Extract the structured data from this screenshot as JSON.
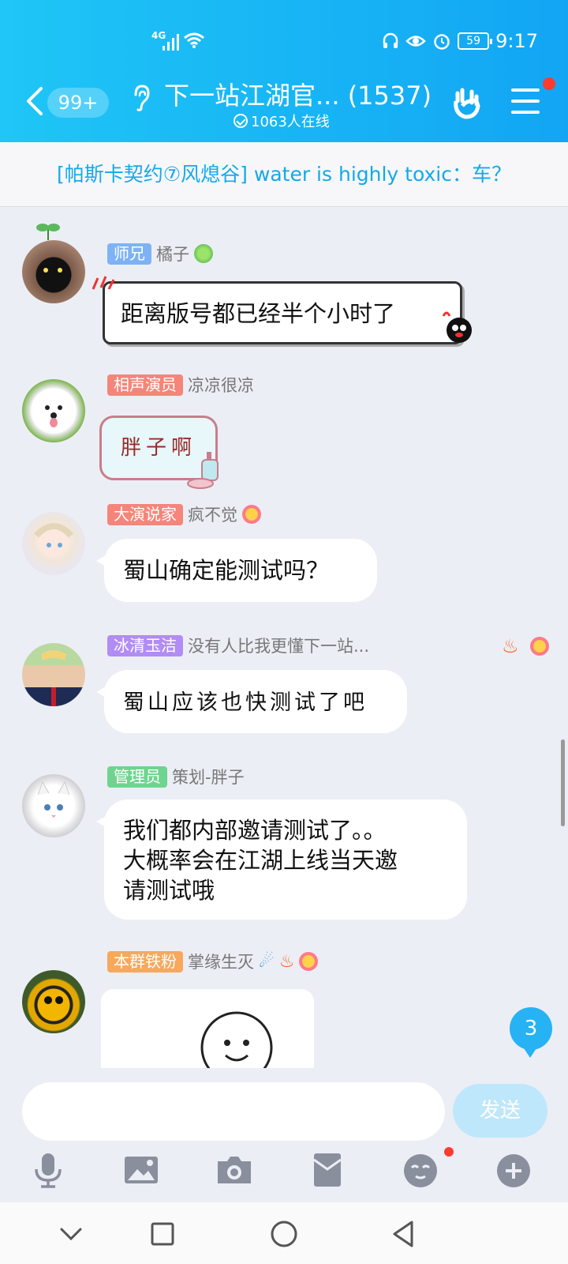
{
  "status": {
    "network": "4G",
    "battery": "59",
    "time": "9:17"
  },
  "header": {
    "unread_count": "99+",
    "group_title": "下一站江湖官... (1537)",
    "online_text": "1063人在线"
  },
  "announcement": "[帕斯卡契约⑦风熄谷] water is highly toxic：车？",
  "messages": [
    {
      "badge": "师兄",
      "badge_color": "#7fb2f5",
      "nick": "橘子",
      "text": "距离版号都已经半个小时了"
    },
    {
      "badge": "相声演员",
      "badge_color": "#f5857a",
      "nick": "凉凉很凉",
      "text": "胖子啊"
    },
    {
      "badge": "大演说家",
      "badge_color": "#f5857a",
      "nick": "疯不觉",
      "text": "蜀山确定能测试吗？"
    },
    {
      "badge": "冰清玉洁",
      "badge_color": "#b28cf5",
      "nick": "没有人比我更懂下一站...",
      "text": "蜀山应该也快测试了吧"
    },
    {
      "badge": "管理员",
      "badge_color": "#6fd48f",
      "nick": "策划-胖子",
      "text_lines": [
        "我们都内部邀请测试了。。",
        "大概率会在江湖上线当天邀",
        "请测试哦"
      ]
    },
    {
      "badge": "本群铁粉",
      "badge_color": "#f7a85c",
      "nick": "掌缘生灭"
    }
  ],
  "new_message_count": "3",
  "input": {
    "placeholder": "",
    "send_label": "发送"
  },
  "toolbar": [
    "mic-icon",
    "image-icon",
    "camera-icon",
    "red-packet-icon",
    "emoji-icon",
    "plus-icon"
  ],
  "colors": {
    "header_start": "#1fc6f6",
    "header_end": "#12a5f4",
    "accent": "#13a9ea",
    "chat_bg": "#eceef5"
  }
}
